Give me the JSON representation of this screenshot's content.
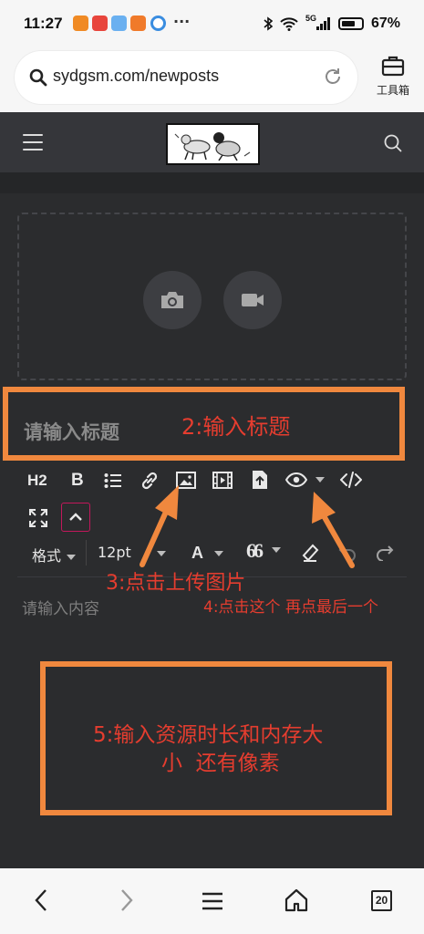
{
  "status_bar": {
    "time": "11:27",
    "overflow": "···",
    "network": "5G",
    "battery": "67%"
  },
  "browser": {
    "url": "sydgsm.com/newposts",
    "toolbox_label": "工具箱",
    "tab_count": "20"
  },
  "editor": {
    "title_placeholder": "请输入标题",
    "content_placeholder": "请输入内容",
    "toolbar": {
      "h2": "H2",
      "bold": "B",
      "format": "格式",
      "font_size": "12pt",
      "font_color": "A",
      "quote": "66"
    }
  },
  "annotations": {
    "step2": "2:输入标题",
    "step3": "3:点击上传图片",
    "step4": "4:点击这个 再点最后一个",
    "step5_line1": "5:输入资源时长和内存大",
    "step5_line2": "小  还有像素"
  },
  "colors": {
    "annotation_box": "#f0883e",
    "annotation_text": "#e53d2f",
    "editor_bg": "#2b2c2e"
  }
}
